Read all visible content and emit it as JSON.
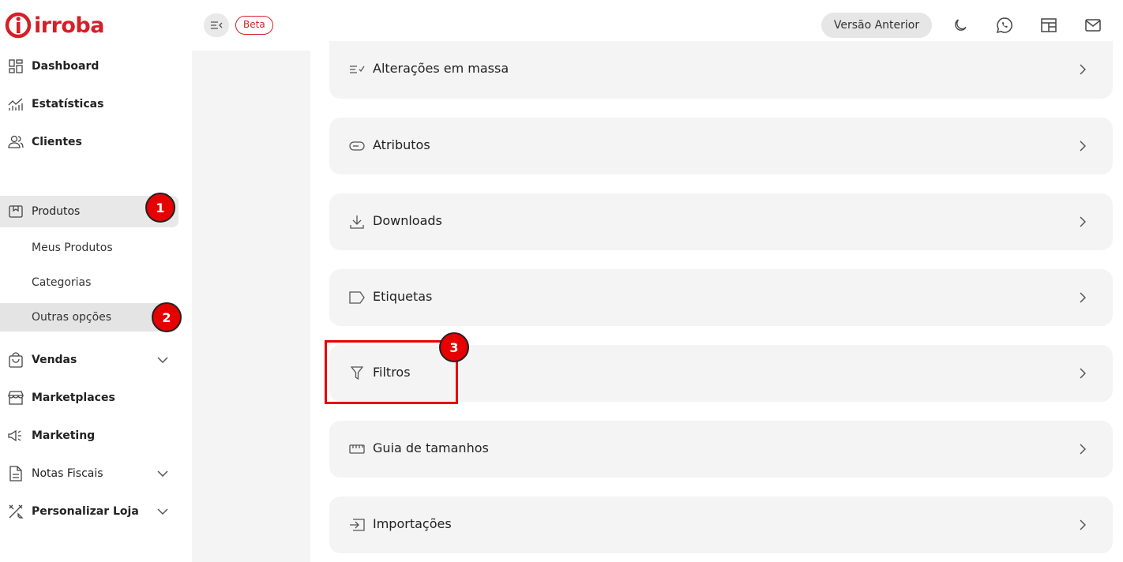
{
  "brand": {
    "name": "irroba",
    "color": "#d61f26"
  },
  "header": {
    "collapse_icon": "sidebar-collapse-icon",
    "beta_label": "Beta",
    "previous_version_label": "Versão Anterior",
    "icons": [
      "moon-icon",
      "whatsapp-icon",
      "layout-icon",
      "mail-icon"
    ]
  },
  "sidebar": {
    "items": [
      {
        "label": "Dashboard",
        "icon": "dashboard-icon"
      },
      {
        "label": "Estatísticas",
        "icon": "chart-icon"
      },
      {
        "label": "Clientes",
        "icon": "users-icon"
      },
      {
        "label": "Produtos",
        "icon": "box-icon",
        "active": true,
        "subitems": [
          "Meus Produtos",
          "Categorias",
          "Outras opções"
        ]
      },
      {
        "label": "Vendas",
        "icon": "bag-icon",
        "expandable": true
      },
      {
        "label": "Marketplaces",
        "icon": "store-icon"
      },
      {
        "label": "Marketing",
        "icon": "megaphone-icon"
      },
      {
        "label": "Notas Fiscais",
        "icon": "document-icon",
        "expandable": true
      },
      {
        "label": "Personalizar Loja",
        "icon": "tools-icon",
        "expandable": true
      }
    ]
  },
  "annotations": {
    "badge1": "1",
    "badge2": "2",
    "badge3": "3"
  },
  "cards": [
    {
      "label": "Alterações em massa",
      "icon": "bulk-edit-icon"
    },
    {
      "label": "Atributos",
      "icon": "tag-pill-icon"
    },
    {
      "label": "Downloads",
      "icon": "download-icon"
    },
    {
      "label": "Etiquetas",
      "icon": "label-icon"
    },
    {
      "label": "Filtros",
      "icon": "filter-icon"
    },
    {
      "label": "Guia de tamanhos",
      "icon": "ruler-icon"
    },
    {
      "label": "Importações",
      "icon": "import-icon"
    }
  ]
}
